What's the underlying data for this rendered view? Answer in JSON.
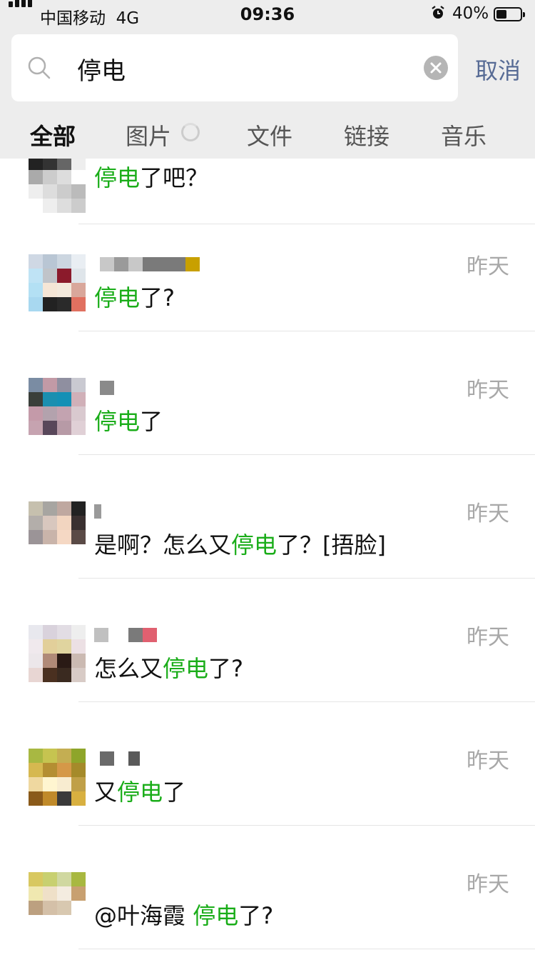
{
  "status_bar": {
    "carrier": "中国移动",
    "network": "4G",
    "time": "09:36",
    "battery_percent": "40%",
    "battery_level": 0.4
  },
  "search": {
    "query": "停电",
    "cancel_label": "取消"
  },
  "tabs": [
    {
      "label": "全部",
      "active": true
    },
    {
      "label": "图片",
      "active": false
    },
    {
      "label": "文件",
      "active": false
    },
    {
      "label": "链接",
      "active": false
    },
    {
      "label": "音乐",
      "active": false
    }
  ],
  "colors": {
    "highlight": "#1aad19",
    "cancel": "#576b95",
    "date": "#a8a8a8",
    "header_bg": "#ededed"
  },
  "results": [
    {
      "date": "",
      "msg_pre": "",
      "msg_hl": "停电",
      "msg_post": "了吧？"
    },
    {
      "date": "昨天",
      "msg_pre": "",
      "msg_hl": "停电",
      "msg_post": "了?"
    },
    {
      "date": "昨天",
      "msg_pre": "",
      "msg_hl": "停电",
      "msg_post": "了"
    },
    {
      "date": "昨天",
      "msg_pre": "是啊？怎么又",
      "msg_hl": "停电",
      "msg_post": "了？[捂脸]"
    },
    {
      "date": "昨天",
      "msg_pre": "怎么又",
      "msg_hl": "停电",
      "msg_post": "了?"
    },
    {
      "date": "昨天",
      "msg_pre": "又",
      "msg_hl": "停电",
      "msg_post": "了"
    },
    {
      "date": "昨天",
      "msg_pre": "@叶海霞 ",
      "msg_hl": "停电",
      "msg_post": "了?"
    }
  ]
}
